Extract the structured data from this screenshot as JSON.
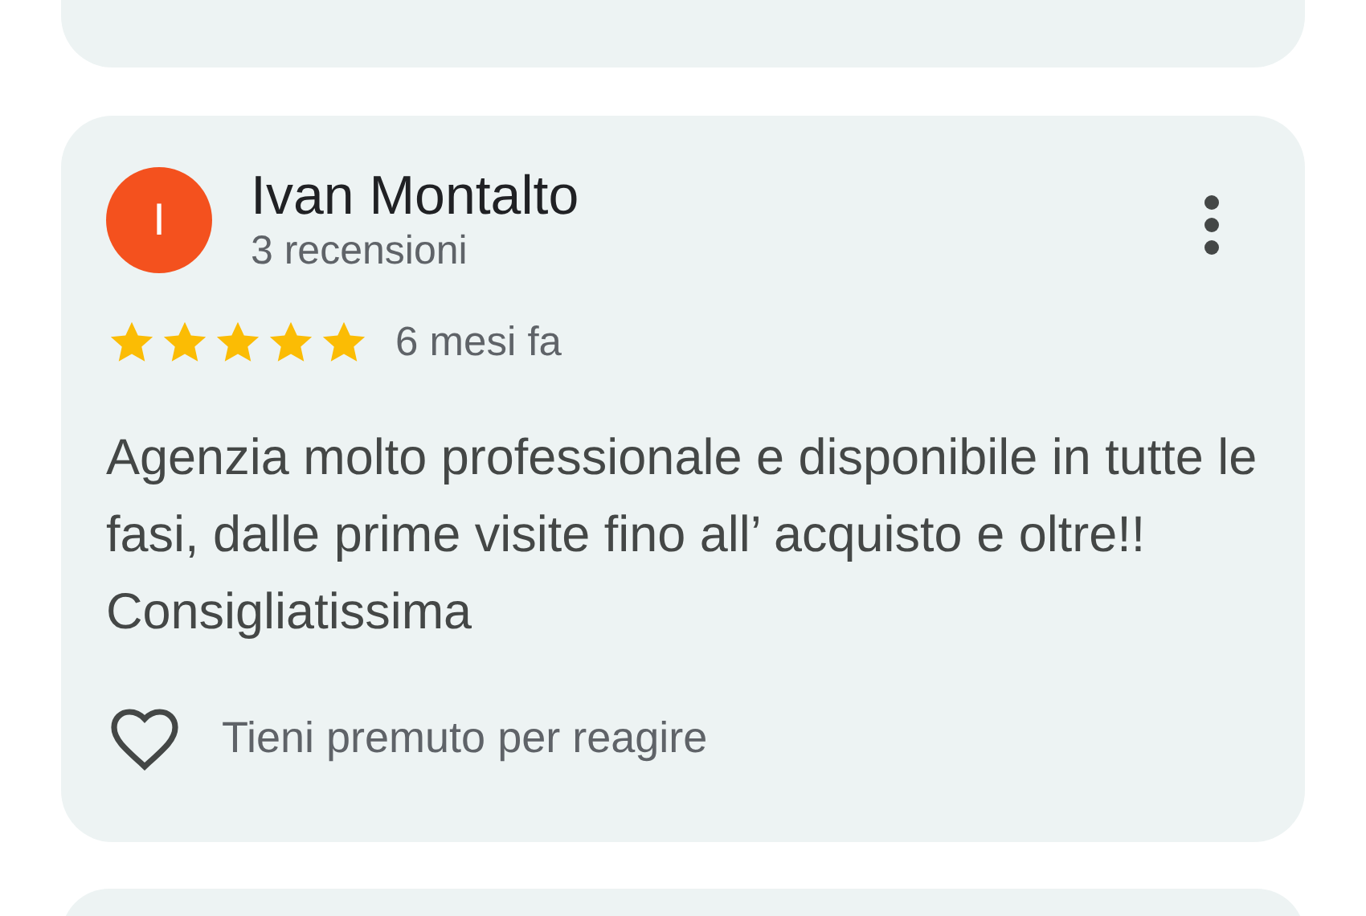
{
  "review": {
    "avatar_letter": "I",
    "author": "Ivan Montalto",
    "review_count": "3 recensioni",
    "stars": 5,
    "time": "6 mesi fa",
    "text": "Agenzia molto professionale e disponibile in tutte le fasi, dalle prime visite fino all’ acquisto e oltre!! Consigliatissima",
    "reaction_hint": "Tieni premuto per reagire"
  }
}
